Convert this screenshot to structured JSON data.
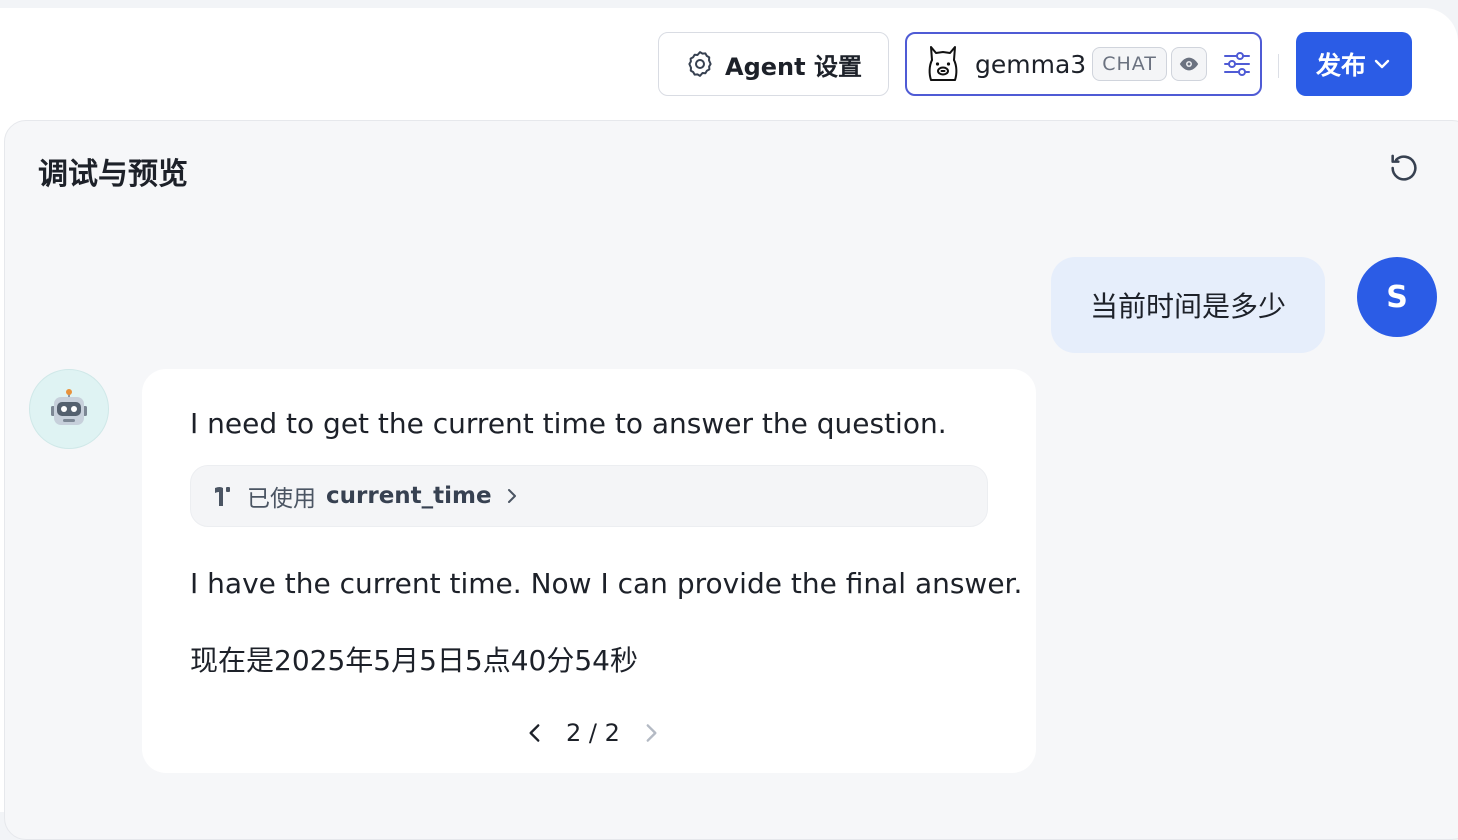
{
  "header": {
    "agent_settings_label": "Agent 设置",
    "model": {
      "name": "gemma3",
      "type_tag": "CHAT"
    },
    "publish_label": "发布"
  },
  "panel": {
    "title": "调试与预览"
  },
  "chat": {
    "user": {
      "avatar_letter": "S",
      "message": "当前时间是多少"
    },
    "bot": {
      "avatar_icon": "🤖",
      "thought1": "I need to get the current time to answer the question.",
      "tool": {
        "prefix": "已使用",
        "name": "current_time"
      },
      "thought2": "I have the current time. Now I can provide the final answer.",
      "answer": "现在是2025年5月5日5点40分54秒",
      "pagination": "2 / 2"
    }
  },
  "colors": {
    "accent": "#2b5ce6",
    "model_border": "#4f5bd5",
    "user_bubble": "#e6eefb"
  }
}
